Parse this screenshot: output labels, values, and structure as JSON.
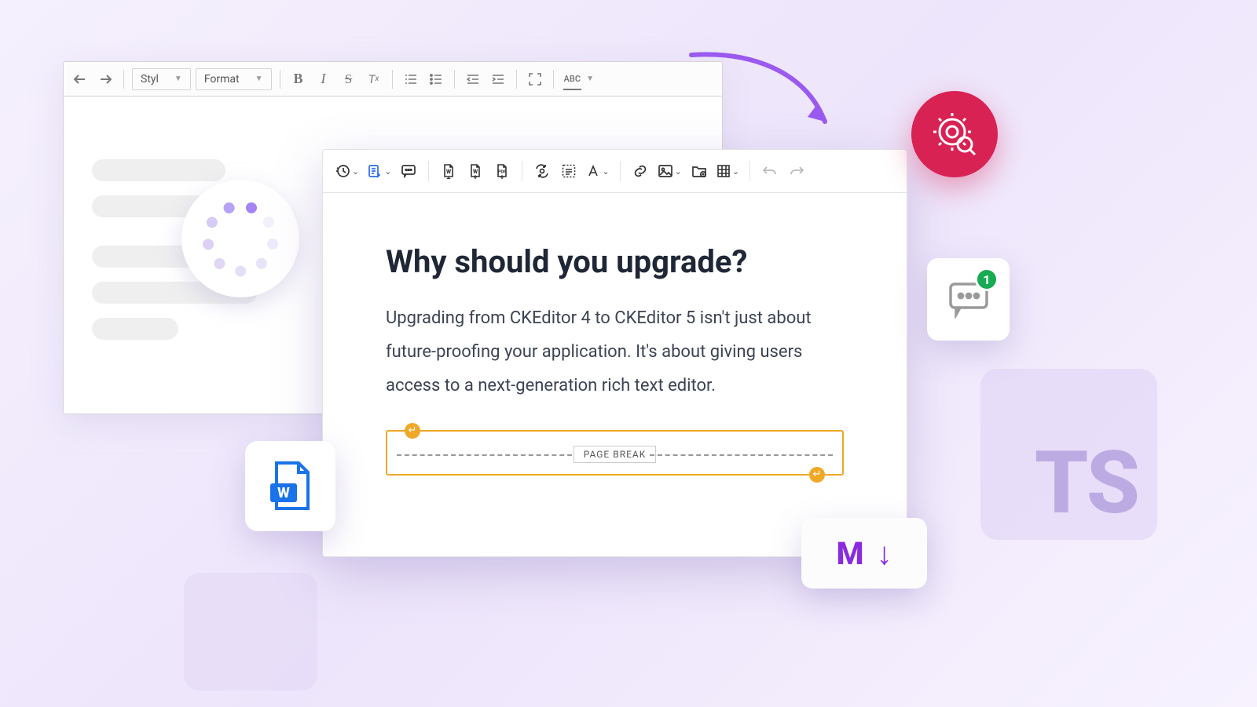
{
  "old_editor": {
    "undo": "↶",
    "redo": "↷",
    "styles_label": "Styl",
    "format_label": "Format",
    "bold": "B",
    "italic": "I",
    "strike": "S",
    "clear": "Tx",
    "numlist": "numbered-list",
    "bullist": "bullet-list",
    "outdent": "outdent",
    "indent": "indent",
    "fullscreen": "fullscreen",
    "spellcheck": "ABC"
  },
  "new_toolbar": {
    "history": "history",
    "track": "track-changes",
    "comment": "comment",
    "import_word": "import-word",
    "export_word": "export-word",
    "export_pdf": "export-pdf",
    "find_replace": "find-replace",
    "select_all": "select-all",
    "font_family": "font",
    "link": "link",
    "image": "image",
    "file": "file",
    "table": "table",
    "undo": "undo",
    "redo": "redo"
  },
  "content": {
    "heading": "Why should you upgrade?",
    "para": "Upgrading from CKEditor 4 to CKEditor 5 isn't just about future-proofing your application. It's about giving users access to a next-generation rich text editor.",
    "page_break_label": "PAGE BREAK"
  },
  "badges": {
    "comment_count": "1"
  },
  "md": {
    "m": "M",
    "arrow": "↓"
  },
  "ts": {
    "label": "TS"
  }
}
